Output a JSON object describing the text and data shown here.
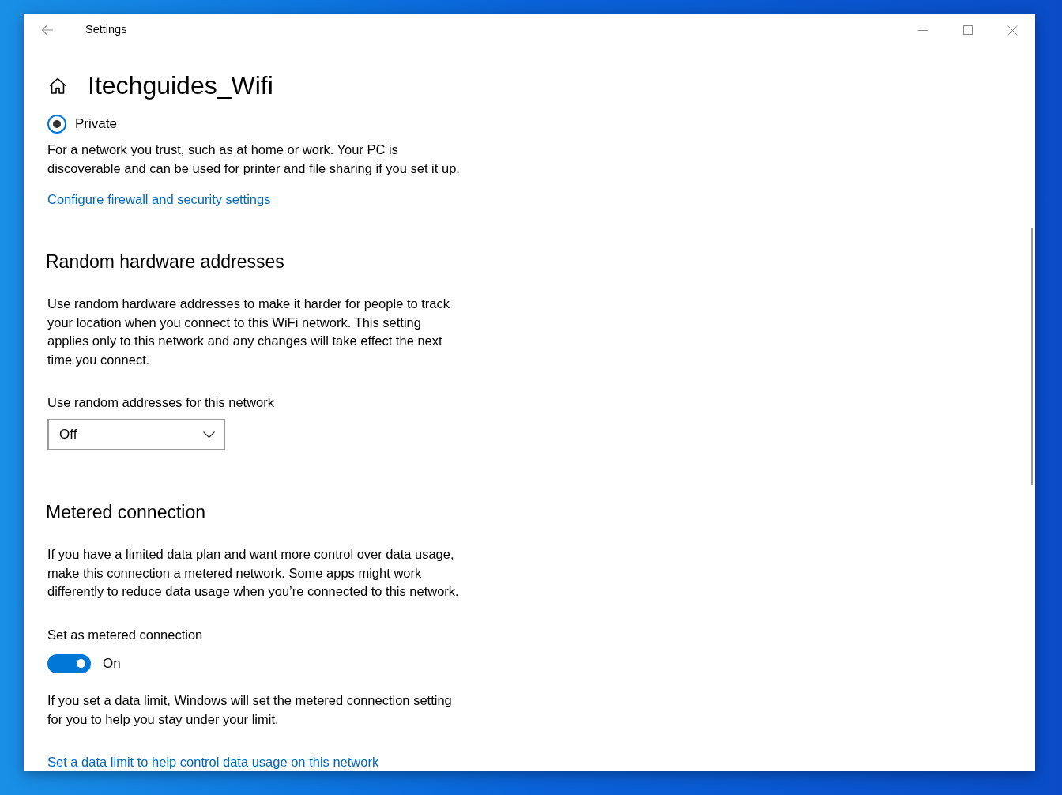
{
  "window": {
    "title": "Settings"
  },
  "page": {
    "title": "Itechguides_Wifi"
  },
  "network_profile": {
    "options": [
      {
        "label": "Private",
        "selected": true,
        "description": "For a network you trust, such as at home or work. Your PC is\ndiscoverable and can be used for printer and file sharing if you set it up."
      }
    ],
    "link": "Configure firewall and security settings"
  },
  "sections": [
    {
      "heading": "Random hardware addresses",
      "description": "Use random hardware addresses to make it harder for people to track\nyour location when you connect to this WiFi network. This setting\napplies only to this network and any changes will take effect the next\ntime you connect.",
      "settings": [
        {
          "kind": "dropdown",
          "label": "Use random addresses for this network",
          "value": "Off"
        }
      ]
    },
    {
      "heading": "Metered connection",
      "description": "If you have a limited data plan and want more control over data usage,\nmake this connection a metered network. Some apps might work\ndifferently to reduce data usage when you’re connected to this network.",
      "settings": [
        {
          "kind": "toggle",
          "label": "Set as metered connection",
          "on": true,
          "state_label": "On"
        }
      ],
      "note": "If you set a data limit, Windows will set the metered connection setting\nfor you to help you stay under your limit.",
      "link": "Set a data limit to help control data usage on this network"
    }
  ]
}
